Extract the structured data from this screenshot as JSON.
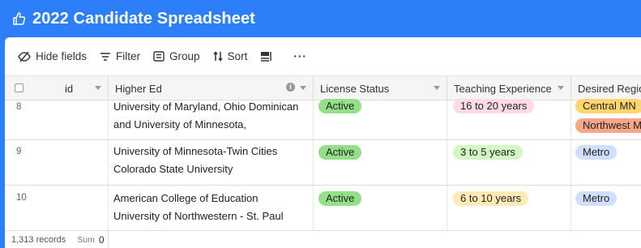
{
  "app": {
    "title": "2022 Candidate Spreadsheet",
    "icon": "thumbs-up-icon"
  },
  "toolbar": {
    "hide_fields": "Hide fields",
    "filter": "Filter",
    "group": "Group",
    "sort": "Sort",
    "more": "···"
  },
  "columns": {
    "id": "id",
    "higher_ed": "Higher Ed",
    "license_status": "License Status",
    "teaching_experience": "Teaching Experience",
    "desired_region": "Desired Regio"
  },
  "rows": [
    {
      "num": "8",
      "higher_ed": [
        "University of  Maryland, Ohio Dominican",
        "and University of Minnesota,"
      ],
      "license": "Active",
      "experience": "16 to 20 years",
      "regions": [
        "Central MN",
        "Northwest M"
      ]
    },
    {
      "num": "9",
      "higher_ed": [
        "University of Minnesota-Twin Cities",
        "Colorado State University"
      ],
      "license": "Active",
      "experience": "3 to 5 years",
      "regions": [
        "Metro"
      ]
    },
    {
      "num": "10",
      "higher_ed": [
        "American College of Education",
        "University of Northwestern - St. Paul"
      ],
      "license": "Active",
      "experience": "6 to 10 years",
      "regions": [
        "Metro"
      ]
    }
  ],
  "footer": {
    "records": "1,313 records",
    "sum_label": "Sum",
    "sum_value": "0"
  },
  "colors": {
    "header_blue": "#2d7ff9",
    "active_green": "#93e088",
    "metro_blue": "#d0e0fc"
  }
}
